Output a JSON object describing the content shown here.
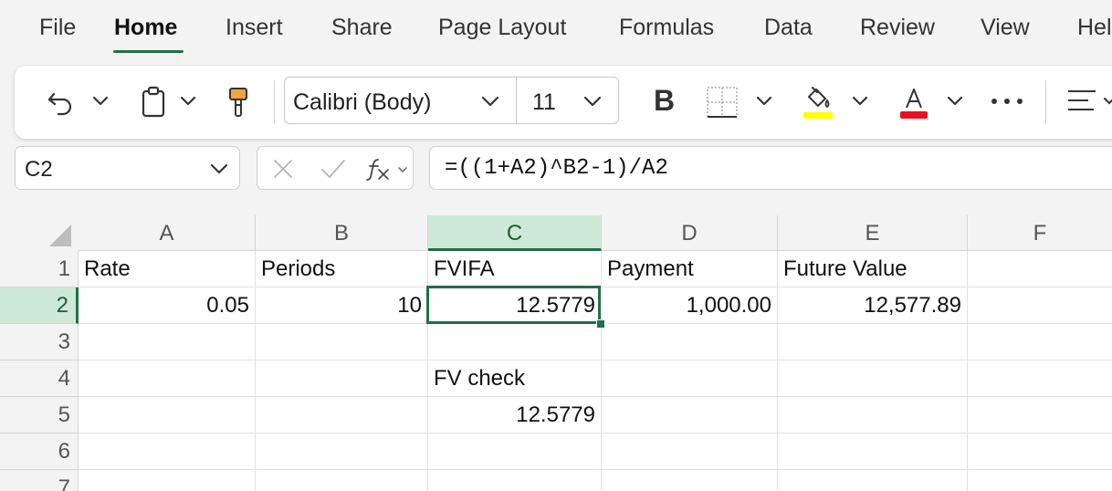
{
  "menu": {
    "tabs": [
      "File",
      "Home",
      "Insert",
      "Share",
      "Page Layout",
      "Formulas",
      "Data",
      "Review",
      "View",
      "Help"
    ],
    "active": "Home"
  },
  "ribbon": {
    "font_name": "Calibri (Body)",
    "font_size": "11",
    "bold_label": "B",
    "fill_color": "#ffff00",
    "font_color": "#e81123"
  },
  "formula_bar": {
    "name_box": "C2",
    "formula": "=((1+A2)^B2-1)/A2"
  },
  "grid": {
    "columns": [
      "A",
      "B",
      "C",
      "D",
      "E",
      "F"
    ],
    "rows": [
      "1",
      "2",
      "3",
      "4",
      "5",
      "6",
      "7"
    ],
    "selected_column": "C",
    "selected_row": "2",
    "cells": {
      "A1": "Rate",
      "B1": "Periods",
      "C1": "FVIFA",
      "D1": "Payment",
      "E1": "Future Value",
      "A2": "0.05",
      "B2": "10",
      "C2": "12.5779",
      "D2": "1,000.00",
      "E2": "12,577.89",
      "C4": "FV check",
      "C5": "12.5779"
    }
  },
  "colors": {
    "accent": "#1e7145",
    "selection_header": "#cfe9d8"
  }
}
